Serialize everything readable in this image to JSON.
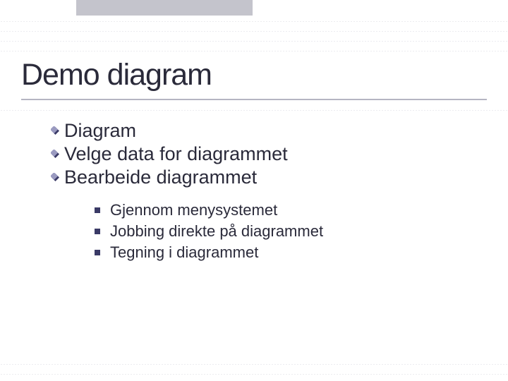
{
  "slide": {
    "title": "Demo diagram",
    "bullets": [
      {
        "text": "Diagram"
      },
      {
        "text": "Velge data for diagrammet"
      },
      {
        "text": "Bearbeide diagrammet"
      }
    ],
    "sub_bullets": [
      {
        "text": "Gjennom menysystemet"
      },
      {
        "text": "Jobbing direkte på diagrammet"
      },
      {
        "text": "Tegning i diagrammet"
      }
    ]
  },
  "theme": {
    "dotted_line_positions": [
      30,
      44,
      58,
      72,
      156,
      516,
      530
    ],
    "accent": "#3a3a66"
  }
}
